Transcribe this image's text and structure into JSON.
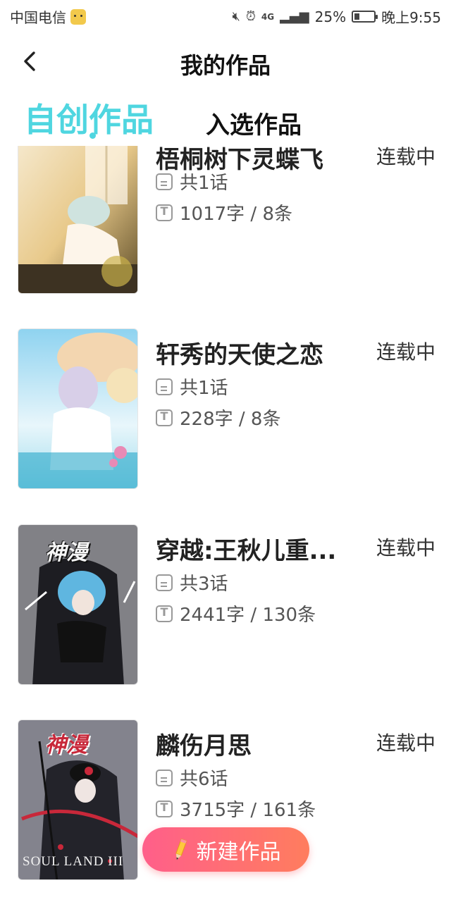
{
  "status_bar": {
    "carrier": "中国电信",
    "battery": "25%",
    "battery_level": 0.25,
    "time": "晚上9:55",
    "network": "4G"
  },
  "header": {
    "title": "我的作品"
  },
  "tabs": [
    {
      "label": "自创作品",
      "active": true
    },
    {
      "label": "入选作品",
      "active": false
    }
  ],
  "works": [
    {
      "title": "梧桐树下灵蝶飞",
      "status": "连载中",
      "chapters": "共1话",
      "stats": "1017字 / 8条",
      "cover_colors": [
        "#e8c98a",
        "#7a6a3e",
        "#f6ead0"
      ]
    },
    {
      "title": "轩秀的天使之恋",
      "status": "连载中",
      "chapters": "共1话",
      "stats": "228字 / 8条",
      "cover_colors": [
        "#8fd3f0",
        "#f3d6b0",
        "#e98ab5"
      ]
    },
    {
      "title": "穿越:王秋儿重...",
      "status": "连载中",
      "chapters": "共3话",
      "stats": "2441字 / 130条",
      "cover_colors": [
        "#2c2c33",
        "#5fb6e0",
        "#c9c9c9"
      ],
      "badge": "神漫"
    },
    {
      "title": "麟伤月思",
      "status": "连载中",
      "chapters": "共6话",
      "stats": "3715字 / 161条",
      "cover_colors": [
        "#3a3a44",
        "#c0c0c8",
        "#c8283a"
      ],
      "badge": "神漫",
      "cover_text": "SOUL LAND III"
    }
  ],
  "new_button": {
    "label": "新建作品"
  },
  "colors": {
    "accent": "#4fd6e0",
    "button_start": "#ff5f8a",
    "button_end": "#ff7d5e"
  }
}
